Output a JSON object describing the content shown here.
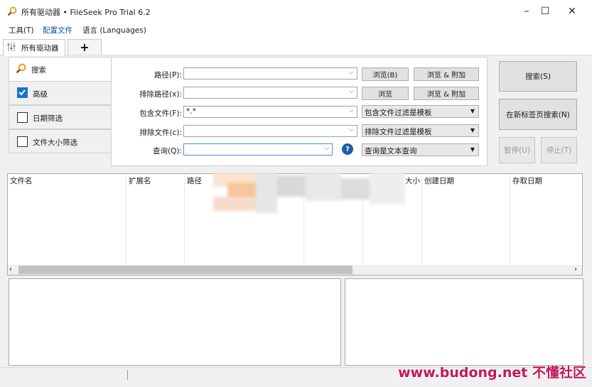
{
  "window": {
    "title": "所有驱动器 • FileSeek Pro Trial 6.2",
    "controls": {
      "minimize": "–",
      "maximize": "☐",
      "close": "✕"
    }
  },
  "menu": {
    "items": [
      {
        "label": "工具(T)"
      },
      {
        "label": "配置文件"
      },
      {
        "label": "语言 (Languages)"
      }
    ]
  },
  "tabs": {
    "items": [
      {
        "label": "所有驱动器"
      }
    ],
    "add_label": "+"
  },
  "options": {
    "search": {
      "label": "搜索"
    },
    "advanced": {
      "label": "高级",
      "checked": true
    },
    "date_filter": {
      "label": "日期筛选",
      "checked": false
    },
    "size_filter": {
      "label": "文件大小筛选",
      "checked": false
    }
  },
  "form": {
    "path": {
      "label": "路径(P):",
      "value": "",
      "browse": "浏览(B)",
      "browse_append": "浏览 & 附加"
    },
    "exclude_path": {
      "label": "排除路径(x):",
      "value": "",
      "browse": "浏览",
      "browse_append": "浏览 & 附加"
    },
    "include_files": {
      "label": "包含文件(F):",
      "value": "*.*",
      "mode": "包含文件过滤是模板"
    },
    "exclude_files": {
      "label": "排除文件(c):",
      "value": "",
      "mode": "排除文件过滤是模板"
    },
    "query": {
      "label": "查询(Q):",
      "value": "",
      "help": "?",
      "mode": "查询是文本查询"
    }
  },
  "actions": {
    "search": "搜索(S)",
    "search_new_tab": "在新标签页搜索(N)",
    "pause": "暂停(U)",
    "stop": "停止(T)"
  },
  "results": {
    "columns": [
      "文件名",
      "扩展名",
      "路径",
      "大小",
      "创建日期",
      "存取日期"
    ]
  },
  "watermark": "www.budong.net 不懂社区",
  "colors": {
    "accent": "#1a73c9",
    "watermark": "#c2185b",
    "window_bg": "#f0f0f0"
  }
}
